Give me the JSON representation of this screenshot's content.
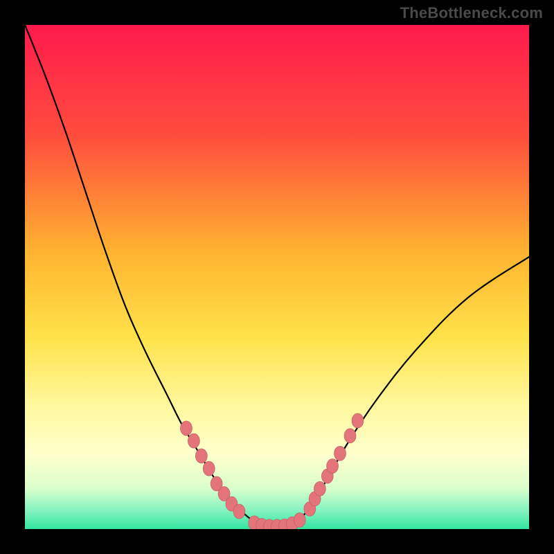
{
  "watermark": "TheBottleneck.com",
  "colors": {
    "background": "#000000",
    "gradient_stops": [
      {
        "offset": 0.0,
        "color": "#ff1a4d"
      },
      {
        "offset": 0.22,
        "color": "#ff4d3d"
      },
      {
        "offset": 0.45,
        "color": "#ffb330"
      },
      {
        "offset": 0.62,
        "color": "#ffe24a"
      },
      {
        "offset": 0.75,
        "color": "#fff79a"
      },
      {
        "offset": 0.85,
        "color": "#ffffcc"
      },
      {
        "offset": 0.92,
        "color": "#d9ffcc"
      },
      {
        "offset": 0.965,
        "color": "#80f2c0"
      },
      {
        "offset": 1.0,
        "color": "#33e59f"
      }
    ],
    "curve": "#000000",
    "marker_fill": "#e2747a",
    "marker_stroke": "#b85a60"
  },
  "chart_data": {
    "type": "line",
    "title": "",
    "xlabel": "",
    "ylabel": "",
    "xlim": [
      0,
      100
    ],
    "ylim": [
      0,
      100
    ],
    "series": [
      {
        "name": "bottleneck-curve",
        "x": [
          0,
          4,
          8,
          12,
          16,
          20,
          24,
          28,
          31,
          34,
          37,
          39,
          41,
          43,
          44.5,
          46,
          48,
          50,
          52,
          54,
          55.5,
          57,
          60,
          64,
          70,
          78,
          88,
          100
        ],
        "y": [
          100,
          90,
          79,
          67,
          55,
          44,
          35,
          27,
          21,
          16,
          11,
          8,
          5.5,
          3.5,
          2.2,
          1.4,
          0.7,
          0.5,
          0.7,
          1.6,
          3,
          5,
          10,
          17,
          26,
          36,
          46,
          54
        ]
      }
    ],
    "markers": [
      {
        "name": "left-cluster",
        "points": [
          {
            "x": 32.0,
            "y": 20.0
          },
          {
            "x": 33.5,
            "y": 17.5
          },
          {
            "x": 35.0,
            "y": 14.5
          },
          {
            "x": 36.5,
            "y": 12.0
          },
          {
            "x": 38.0,
            "y": 9.0
          },
          {
            "x": 39.5,
            "y": 7.0
          },
          {
            "x": 41.0,
            "y": 5.0
          },
          {
            "x": 42.5,
            "y": 3.5
          }
        ]
      },
      {
        "name": "bottom-cluster",
        "points": [
          {
            "x": 45.5,
            "y": 1.2
          },
          {
            "x": 47.0,
            "y": 0.7
          },
          {
            "x": 48.5,
            "y": 0.5
          },
          {
            "x": 50.0,
            "y": 0.5
          },
          {
            "x": 51.5,
            "y": 0.6
          },
          {
            "x": 53.0,
            "y": 1.0
          },
          {
            "x": 54.5,
            "y": 1.8
          }
        ]
      },
      {
        "name": "right-cluster",
        "points": [
          {
            "x": 56.5,
            "y": 4.0
          },
          {
            "x": 57.5,
            "y": 6.0
          },
          {
            "x": 58.5,
            "y": 8.0
          },
          {
            "x": 60.0,
            "y": 10.5
          },
          {
            "x": 61.0,
            "y": 12.5
          },
          {
            "x": 62.5,
            "y": 15.0
          },
          {
            "x": 64.5,
            "y": 18.5
          },
          {
            "x": 66.0,
            "y": 21.5
          }
        ]
      }
    ]
  }
}
